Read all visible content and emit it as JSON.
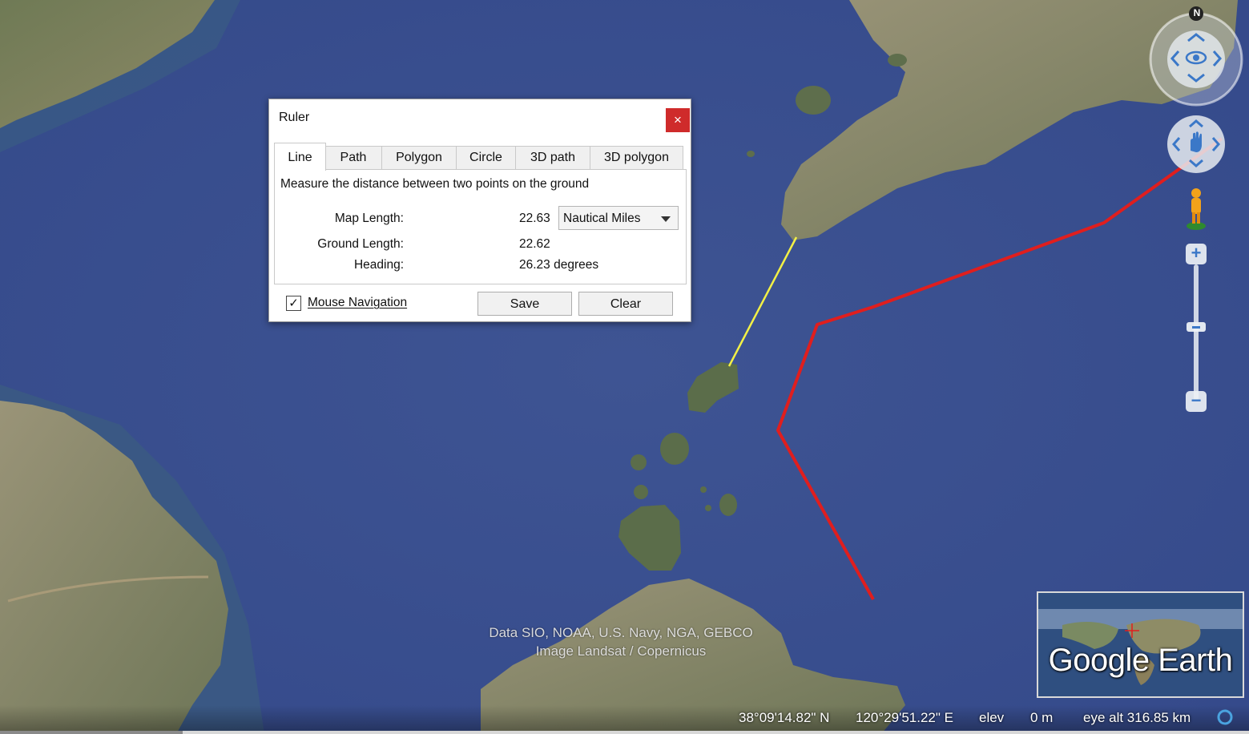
{
  "map": {
    "attribution": [
      "Data SIO, NOAA, U.S. Navy, NGA, GEBCO",
      "Image Landsat / Copernicus"
    ],
    "colors": {
      "sea": "#3f5594",
      "land": "#8a8a5e",
      "ruler_line": "#f2f046",
      "path": "#e01e1e"
    }
  },
  "status": {
    "lat": "38°09'14.82\" N",
    "lon": "120°29'51.22\" E",
    "elev_label": "elev",
    "elev_value": "0 m",
    "eye_alt": "eye alt 316.85 km"
  },
  "ruler": {
    "title": "Ruler",
    "close": "×",
    "tabs": [
      "Line",
      "Path",
      "Polygon",
      "Circle",
      "3D path",
      "3D polygon"
    ],
    "active_tab": "Line",
    "description": "Measure the distance between two points on the ground",
    "map_length_label": "Map Length:",
    "map_length_value": "22.63",
    "units": "Nautical Miles",
    "ground_length_label": "Ground Length:",
    "ground_length_value": "22.62",
    "heading_label": "Heading:",
    "heading_value": "26.23 degrees",
    "mouse_nav_label": "Mouse Navigation",
    "mouse_nav_checked": true,
    "mouse_nav_check_glyph": "✓",
    "save_label": "Save",
    "clear_label": "Clear"
  },
  "nav": {
    "north_label": "N",
    "zoom_in": "+",
    "zoom_out": "−"
  },
  "overview": {
    "brand": "Google Earth"
  }
}
